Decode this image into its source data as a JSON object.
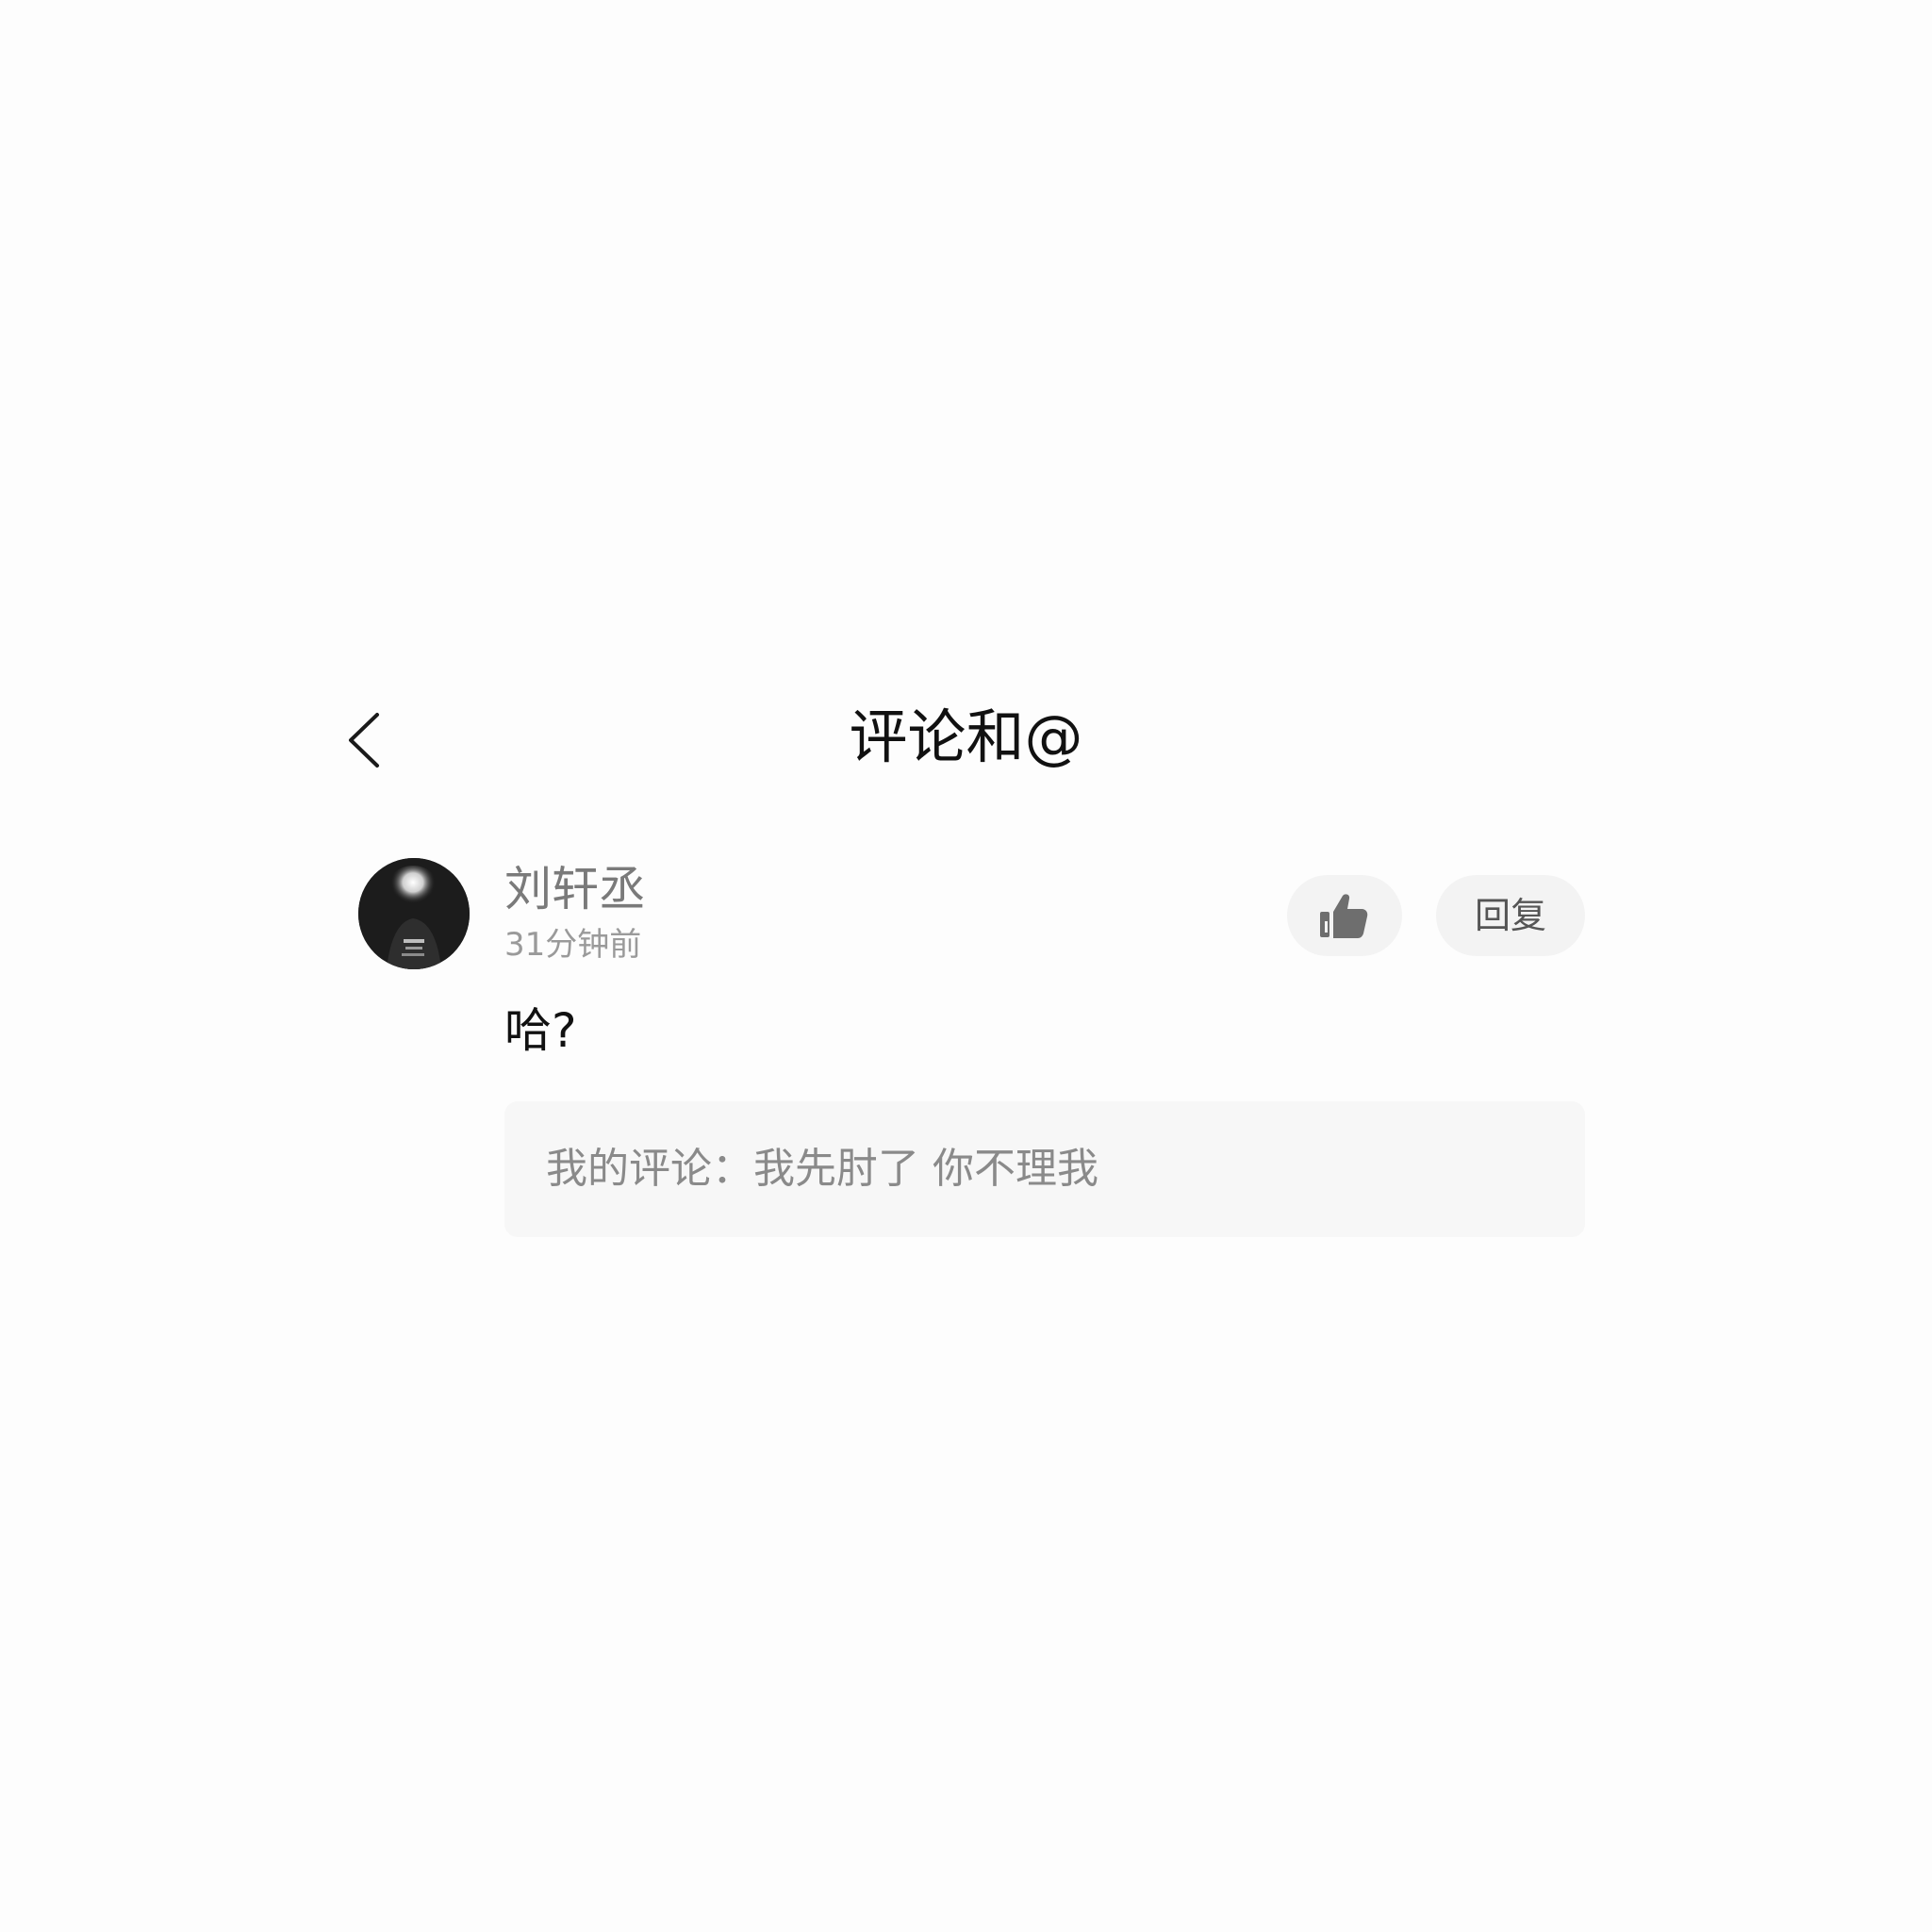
{
  "header": {
    "title": "评论和@",
    "back_icon": "chevron-left-icon"
  },
  "comment": {
    "username": "刘轩丞",
    "timestamp": "31分钟前",
    "text": "哈?",
    "like_icon": "thumbs-up-icon",
    "reply_label": "回复",
    "my_comment": "我的评论：我先肘了 你不理我"
  },
  "colors": {
    "background": "#fdfdfd",
    "pill_background": "#f3f3f3",
    "quote_background": "#f7f7f7",
    "muted_text": "#7a7a7a"
  }
}
